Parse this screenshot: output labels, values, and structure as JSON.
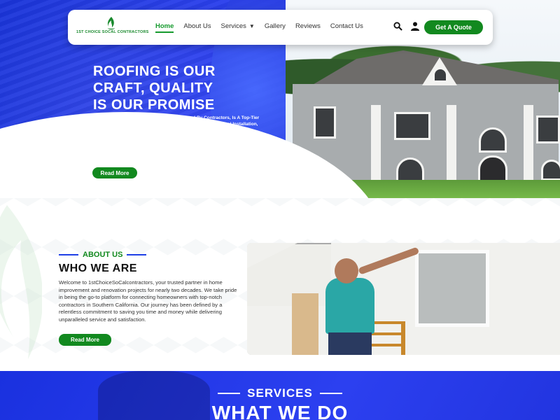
{
  "brand": {
    "logo_text": "1ST CHOICE SOCAL CONTRACTORS",
    "colors": {
      "primary_blue": "#2438e6",
      "accent_green": "#12891f"
    }
  },
  "nav": {
    "items": [
      {
        "label": "Home",
        "active": true
      },
      {
        "label": "About Us",
        "active": false
      },
      {
        "label": "Services",
        "active": false,
        "dropdown": true
      },
      {
        "label": "Gallery",
        "active": false
      },
      {
        "label": "Reviews",
        "active": false
      },
      {
        "label": "Contact Us",
        "active": false
      }
    ],
    "icons": [
      "search-icon",
      "user-icon"
    ],
    "cta_label": "Get A Quote"
  },
  "hero": {
    "title_line1": "ROOFING IS OUR",
    "title_line2": "CRAFT, QUALITY",
    "title_line3": "IS OUR PROMISE",
    "description": "A GAF Certified 50-Year Warranty Roof, Offered By Contractors, Is A Top-Tier Roofing Solution That Combines Quality Materials, Professional Installation, And A Long-Lasting Guarantee. GAF, A Renowned Roofing Manufacturer, Certifies Contractors To Ensure Their Expertise And Commitment To Quality. This Roofing System Typically Includes High-Quality Shingles, Underlayment, And Other Components That Are Built To Withstand The Test Of Time And Various Weather Conditions.",
    "button_label": "Read More"
  },
  "about": {
    "kicker": "ABOUT US",
    "title": "WHO WE ARE",
    "description": "Welcome to 1stChoiceSoCalcontractors, your trusted partner in home improvement and renovation projects for nearly two decades. We take pride in being the go-to platform for connecting homeowners with top-notch contractors in Southern California. Our journey has been defined by a relentless commitment to saving you time and money while delivering unparalleled service and satisfaction.",
    "button_label": "Read More"
  },
  "services": {
    "kicker": "SERVICES",
    "title": "WHAT WE DO"
  }
}
